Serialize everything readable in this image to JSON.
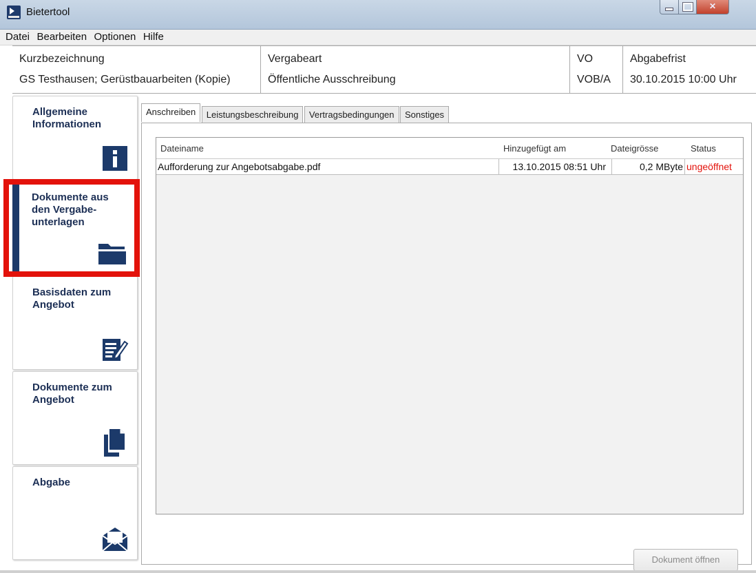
{
  "window": {
    "title": "Bietertool"
  },
  "menu": [
    "Datei",
    "Bearbeiten",
    "Optionen",
    "Hilfe"
  ],
  "info": {
    "kurz_label": "Kurzbezeichnung",
    "kurz_value": "GS Testhausen; Gerüstbauarbeiten (Kopie)",
    "vergabe_label": "Vergabeart",
    "vergabe_value": "Öffentliche Ausschreibung",
    "vo_label": "VO",
    "vo_value": "VOB/A",
    "frist_label": "Abgabefrist",
    "frist_value": "30.10.2015 10:00 Uhr"
  },
  "sidebar": {
    "items": [
      {
        "label": "Allgemeine Informationen",
        "icon": "info-icon"
      },
      {
        "label": "Dokumente aus den Vergabe-unterlagen",
        "icon": "folder-icon"
      },
      {
        "label": "Basisdaten zum Angebot",
        "icon": "edit-document-icon"
      },
      {
        "label": "Dokumente zum Angebot",
        "icon": "documents-icon"
      },
      {
        "label": "Abgabe",
        "icon": "envelope-icon"
      }
    ]
  },
  "tabs": [
    "Anschreiben",
    "Leistungsbeschreibung",
    "Vertragsbedingungen",
    "Sonstiges"
  ],
  "table": {
    "headers": [
      "Dateiname",
      "Hinzugefügt am",
      "Dateigrösse",
      "Status"
    ],
    "rows": [
      [
        "Aufforderung zur Angebotsabgabe.pdf",
        "13.10.2015 08:51 Uhr",
        "0,2 MByte",
        "ungeöffnet"
      ]
    ]
  },
  "actions": {
    "open_document": "Dokument öffnen"
  },
  "colors": {
    "nav_blue": "#1c3a6a",
    "highlight_red": "#e3120b",
    "status_red": "#e3120b"
  }
}
